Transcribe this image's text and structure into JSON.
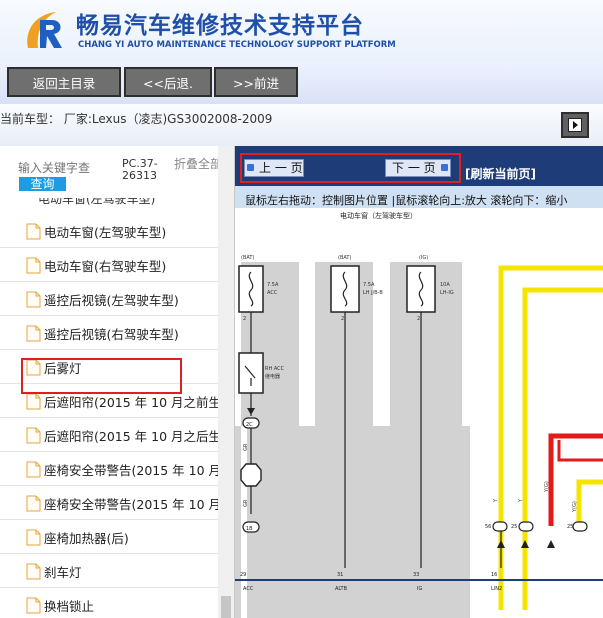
{
  "header": {
    "title": "畅易汽车维修技术支持平台",
    "subtitle": "CHANG YI AUTO MAINTENANCE TECHNOLOGY SUPPORT PLATFORM"
  },
  "nav": {
    "home": "返回主目录",
    "back": "<<后退.",
    "forward": ">>前进"
  },
  "model": {
    "label": "当前车型：   厂家:Lexus（凌志)GS3002008-2009"
  },
  "sidebar": {
    "search_placeholder": "输入关键字查",
    "search_button": "查询",
    "code": "PC.37-26313",
    "collapse": "折叠全部",
    "partial_item": "电动车窗(左驾驶车型)",
    "items": [
      {
        "label": "电动车窗(左驾驶车型)"
      },
      {
        "label": "电动车窗(右驾驶车型)"
      },
      {
        "label": "遥控后视镜(左驾驶车型)"
      },
      {
        "label": "遥控后视镜(右驾驶车型)"
      },
      {
        "label": "后雾灯"
      },
      {
        "label": "后遮阳帘(2015 年 10 月之前生"
      },
      {
        "label": "后遮阳帘(2015 年 10 月之后生"
      },
      {
        "label": "座椅安全带警告(2015 年 10 月"
      },
      {
        "label": "座椅安全带警告(2015 年 10 月"
      },
      {
        "label": "座椅加热器(后)"
      },
      {
        "label": "刹车灯"
      },
      {
        "label": "换档锁止"
      }
    ]
  },
  "viewer": {
    "prev_page": "上 一 页",
    "next_page": "下 一 页",
    "refresh": "[刷新当前页]",
    "hint": "鼠标左右拖动：控制图片位置 |鼠标滚轮向上:放大  滚轮向下：缩小"
  },
  "diagram": {
    "title": "电动车窗（左驾驶车型）",
    "fuse1_tag": "(BAT)",
    "fuse1_rating": "7.5A",
    "fuse1_name": "ACC",
    "fuse1_pin": "2",
    "fuse2_tag": "(BAT)",
    "fuse2_rating": "7.5A",
    "fuse2_name": "LH J/B-B",
    "fuse2_pin": "2",
    "fuse3_tag": "(IG)",
    "fuse3_rating": "10A",
    "fuse3_name": "LH-IG",
    "fuse3_pin": "2",
    "relay_name": "RH ACC",
    "relay_sub": "继电器",
    "conn1": "2C",
    "conn2": "1B",
    "conn3": "2B",
    "wire_color1": "GR",
    "wire_color2": "GR",
    "pin_bottom1": "29",
    "pin_bottom2": "31",
    "pin_bottom3": "33",
    "pin_bottom4": "16",
    "name_bottom1": "ACC",
    "name_bottom2": "ALTB",
    "name_bottom3": "IG",
    "name_bottom4": "LIN2",
    "y_label": "Y",
    "yg_label": "Y(G)",
    "right_pin1": "56",
    "right_pin2": "25",
    "right_pin3": "25",
    "colors": {
      "yellow": "#f5e400",
      "red": "#e21a1a",
      "gray": "#d2d2d2",
      "navy": "#1e3d78"
    }
  }
}
